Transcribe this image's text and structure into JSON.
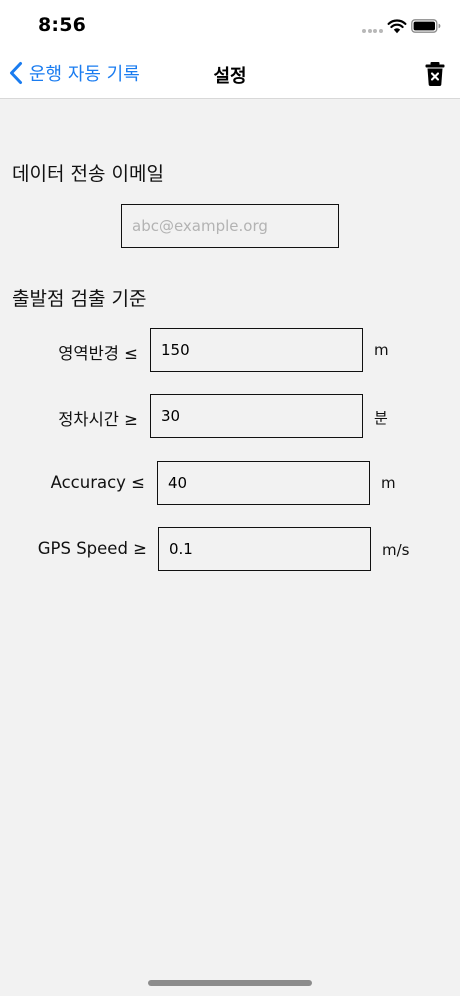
{
  "status_bar": {
    "time": "8:56"
  },
  "nav": {
    "back_label": "운행 자동 기록",
    "title": "설정"
  },
  "email_section": {
    "title": "데이터 전송 이메일",
    "placeholder": "abc@example.org",
    "value": ""
  },
  "detection_section": {
    "title": "출발점 검출 기준",
    "rows": [
      {
        "label": "영역반경 ≤",
        "value": "150",
        "unit": "m"
      },
      {
        "label": "정차시간 ≥",
        "value": "30",
        "unit": "분"
      },
      {
        "label": "Accuracy ≤",
        "value": "40",
        "unit": "m"
      },
      {
        "label": "GPS Speed ≥",
        "value": "0.1",
        "unit": "m/s"
      }
    ]
  },
  "icons": {
    "back": "chevron-left-icon",
    "delete": "trash-icon",
    "wifi": "wifi-icon",
    "battery": "battery-icon"
  },
  "colors": {
    "accent": "#1a7cf0",
    "background": "#f2f2f2",
    "bar": "#ffffff"
  }
}
